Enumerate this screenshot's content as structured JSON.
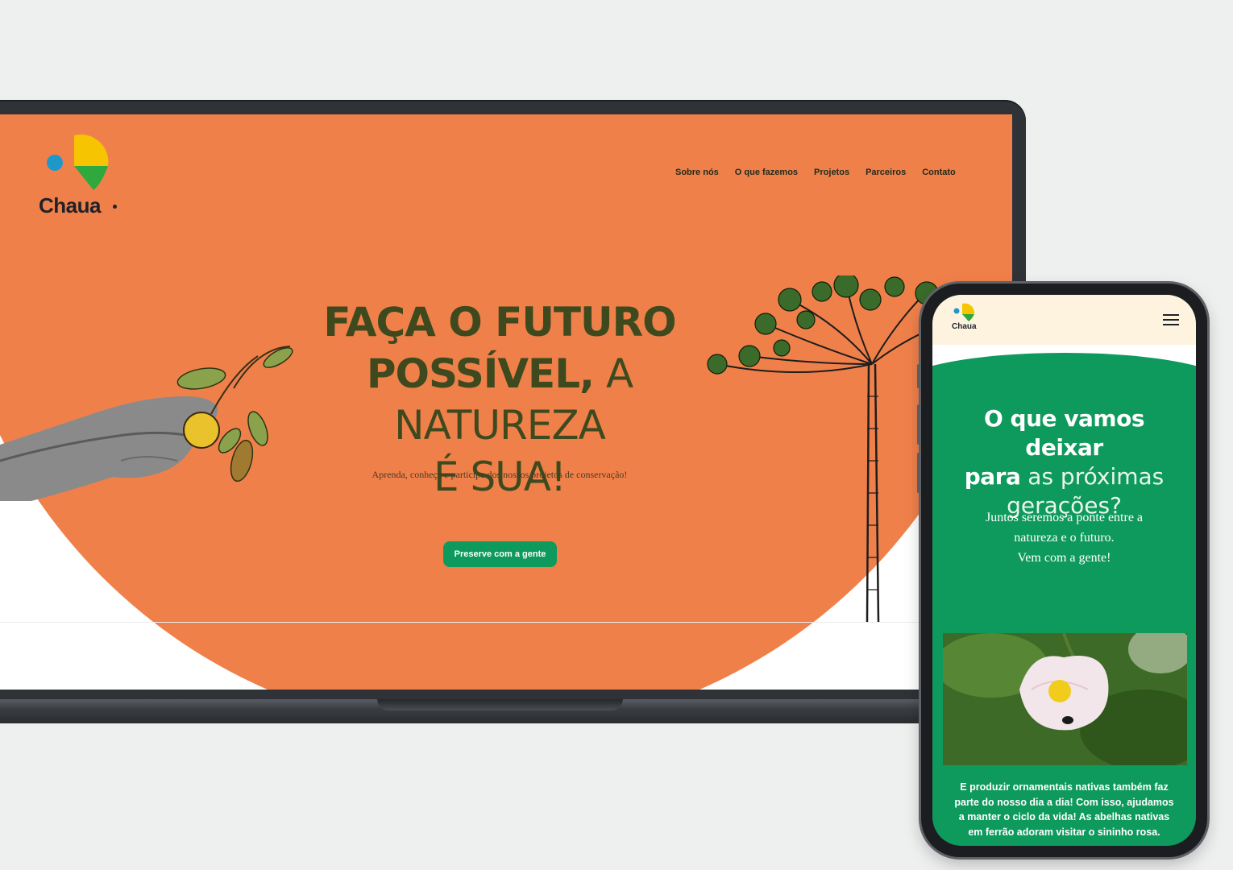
{
  "desktop": {
    "logo": {
      "wordmark": "Chaua"
    },
    "nav": {
      "items": [
        {
          "label": "Sobre nós"
        },
        {
          "label": "O que fazemos"
        },
        {
          "label": "Projetos"
        },
        {
          "label": "Parceiros"
        },
        {
          "label": "Contato"
        }
      ]
    },
    "hero": {
      "line1": "FAÇA O FUTURO",
      "line2_bold": "POSSÍVEL,",
      "line2_light": "A NATUREZA",
      "line3": "É SUA!",
      "subtitle": "Aprenda, conheça e participe dos nossos projetos de conservação!",
      "cta_label": "Preserve com a gente"
    }
  },
  "mobile": {
    "logo": {
      "wordmark": "Chaua"
    },
    "menu_icon": "hamburger-icon",
    "title_bold_1": "O que vamos deixar",
    "title_bold_2": "para",
    "title_light_2": "as próximas",
    "title_light_3": "gerações?",
    "subtitle_1": "Juntos seremos a ponte entre a",
    "subtitle_2": "natureza e o futuro.",
    "subtitle_3": "Vem com a gente!",
    "body_text": "E produzir ornamentais nativas também faz parte do nosso dia a dia! Com isso, ajudamos a manter o ciclo da vida! As abelhas nativas em ferrão adoram visitar o sininho rosa."
  },
  "colors": {
    "hero_orange": "#f0804a",
    "brand_green": "#0e9a5c",
    "headline_olive": "#3e4a1e",
    "logo_blue": "#1d98c9",
    "logo_yellow": "#f6c400",
    "mobile_header_cream": "#fdf3df"
  }
}
